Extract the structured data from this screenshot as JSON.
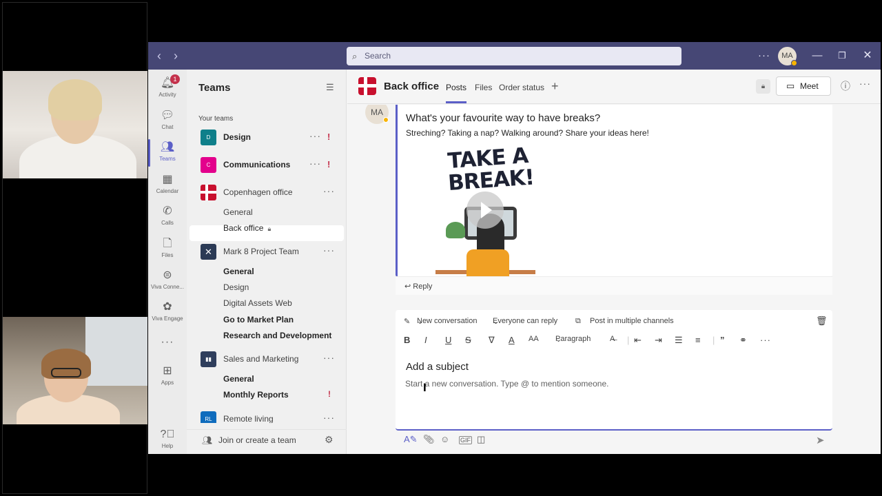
{
  "topbar": {
    "search_placeholder": "Search",
    "user_initials": "MA"
  },
  "rail": {
    "activity": "Activity",
    "activity_badge": "1",
    "chat": "Chat",
    "teams": "Teams",
    "calendar": "Calendar",
    "calls": "Calls",
    "files": "Files",
    "viva_connections": "Viva Conne...",
    "viva_engage": "Viva Engage",
    "apps": "Apps",
    "help": "Help"
  },
  "teams_list": {
    "title": "Teams",
    "section": "Your teams",
    "teams": [
      {
        "initial": "D",
        "name": "Design",
        "color": "#0f7f8a"
      },
      {
        "initial": "C",
        "name": "Communications",
        "color": "#e3008c"
      },
      {
        "name": "Copenhagen office"
      },
      {
        "name": "Mark 8 Project Team"
      },
      {
        "name": "Sales and Marketing"
      },
      {
        "initial": "RL",
        "name": "Remote living",
        "color": "#0f6cbd"
      }
    ],
    "channels": {
      "copenhagen": [
        "General",
        "Back office"
      ],
      "mark8": [
        "General",
        "Design",
        "Digital Assets Web",
        "Go to Market Plan",
        "Research and Development"
      ],
      "sales": [
        "General",
        "Monthly Reports"
      ]
    },
    "join": "Join or create a team"
  },
  "channel": {
    "title": "Back office",
    "tabs": [
      "Posts",
      "Files",
      "Order status"
    ],
    "meet": "Meet"
  },
  "post": {
    "author_initials": "MA",
    "subject": "What's your favourite way to have breaks?",
    "body": "Streching? Taking a nap? Walking around? Share your ideas here!",
    "gif_text": "TAKE A BREAK!",
    "reply": "Reply"
  },
  "composer": {
    "new_conversation": "New conversation",
    "everyone_can_reply": "Everyone can reply",
    "post_multiple": "Post in multiple channels",
    "paragraph": "Paragraph",
    "subject_placeholder": "Add a subject",
    "message_placeholder": "Start a new conversation. Type @ to mention someone."
  },
  "colors": {
    "titlebar": "#464775",
    "accent": "#5b5fc7",
    "urgent": "#c4314b"
  }
}
